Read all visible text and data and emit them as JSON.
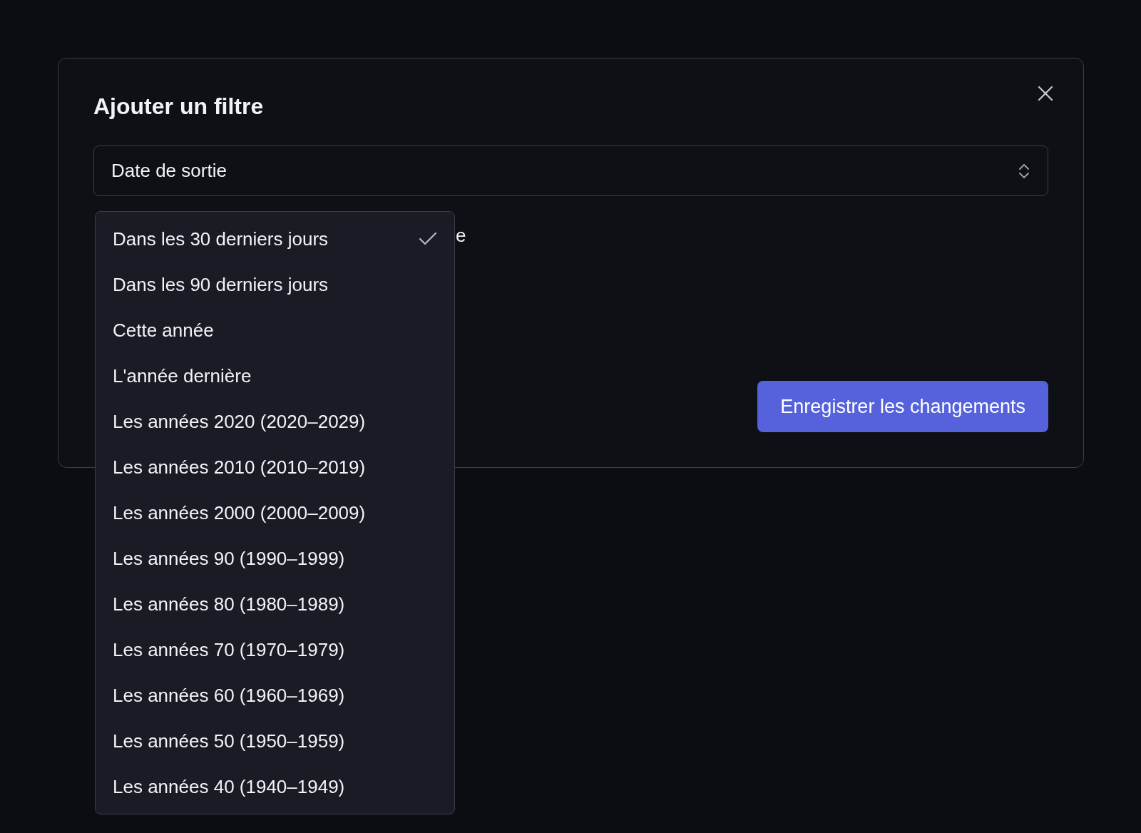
{
  "dialog": {
    "title": "Ajouter un filtre",
    "field": {
      "value": "Date de sortie"
    },
    "covered_label": "e",
    "save_button": "Enregistrer les changements"
  },
  "dropdown": {
    "options": [
      {
        "label": "Dans les 30 derniers jours",
        "selected": true
      },
      {
        "label": "Dans les 90 derniers jours",
        "selected": false
      },
      {
        "label": "Cette année",
        "selected": false
      },
      {
        "label": "L'année dernière",
        "selected": false
      },
      {
        "label": "Les années 2020 (2020–2029)",
        "selected": false
      },
      {
        "label": "Les années 2010 (2010–2019)",
        "selected": false
      },
      {
        "label": "Les années 2000 (2000–2009)",
        "selected": false
      },
      {
        "label": "Les années 90 (1990–1999)",
        "selected": false
      },
      {
        "label": "Les années 80 (1980–1989)",
        "selected": false
      },
      {
        "label": "Les années 70 (1970–1979)",
        "selected": false
      },
      {
        "label": "Les années 60 (1960–1969)",
        "selected": false
      },
      {
        "label": "Les années 50 (1950–1959)",
        "selected": false
      },
      {
        "label": "Les années 40 (1940–1949)",
        "selected": false
      }
    ]
  }
}
